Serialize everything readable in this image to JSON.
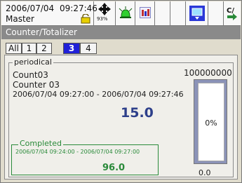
{
  "status": {
    "date": "2006/07/04",
    "time": "09:27:46",
    "user": "Master",
    "memory_percent": "93%"
  },
  "title": "Counter/Totalizer",
  "tabs": [
    "All",
    "1",
    "2",
    "3",
    "4"
  ],
  "active_tab": "3",
  "periodical": {
    "legend": "periodical",
    "tag": "Count03",
    "name": "Counter 03",
    "range": "2006/07/04  09:27:00 - 2006/07/04  09:27:46",
    "value": "15.0",
    "max": "100000000",
    "gauge_percent_label": "0%",
    "gauge_fraction": 0.0,
    "gauge_min": "0.0"
  },
  "completed": {
    "legend": "Completed",
    "range": "2006/07/04  09:24:00 -      2006/07/04  09:27:00",
    "value": "96.0"
  },
  "icons": {
    "cursor": "move-cross-icon",
    "alarm": "alarm-bell-icon",
    "display": "display-grid-icon",
    "screen": "screen-switch-icon",
    "cf": "cf-card-icon"
  },
  "colors": {
    "active_tab": "#2020d8",
    "completed": "#2a8a3a",
    "value": "#2d3f8a"
  }
}
